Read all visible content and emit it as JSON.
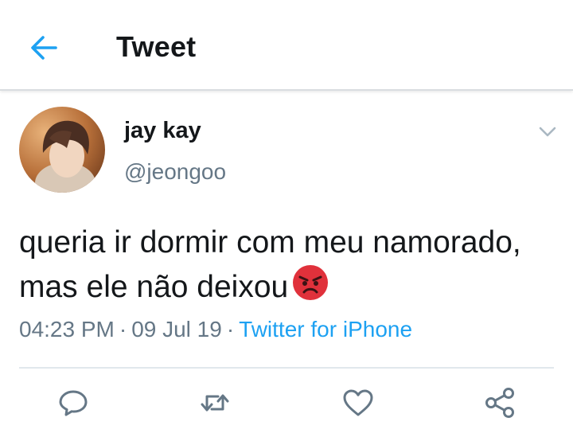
{
  "header": {
    "title": "Tweet",
    "back_icon": "arrow-left-icon"
  },
  "tweet": {
    "author": {
      "display_name": "jay kay",
      "handle": "@jeongoo"
    },
    "text": "queria ir dormir com meu namorado, mas ele não deixou",
    "emoji": "angry-face-emoji",
    "time": "04:23 PM",
    "date": "09 Jul 19",
    "source": "Twitter for iPhone",
    "separator": "·"
  },
  "actions": [
    "reply-icon",
    "retweet-icon",
    "like-icon",
    "share-icon"
  ],
  "colors": {
    "accent": "#1da1f2",
    "secondary_text": "#657786",
    "primary_text": "#14171a",
    "icon": "#657786"
  }
}
